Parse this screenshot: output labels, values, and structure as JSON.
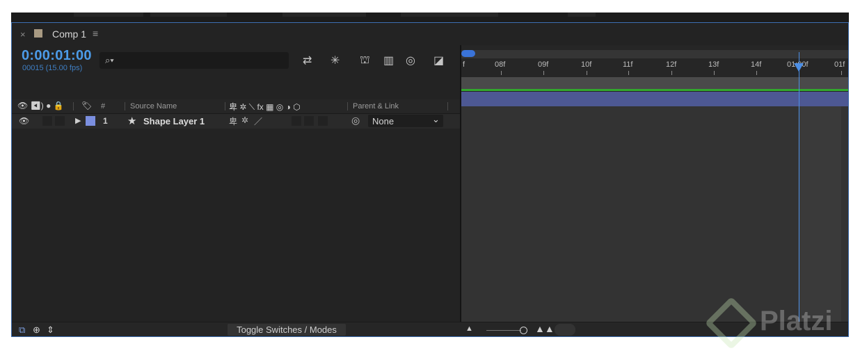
{
  "composition_tab": {
    "close_glyph": "×",
    "label": "Comp 1",
    "menu_glyph": "≡"
  },
  "timecode": {
    "current": "0:00:01:00",
    "frames": "00015 (15.00 fps)"
  },
  "search": {
    "icon": "search-icon",
    "glyph": "⌕▾"
  },
  "toolbar_icons": [
    {
      "name": "comp-mini-flowchart-icon",
      "glyph": "⇄"
    },
    {
      "name": "draft-3d-icon",
      "glyph": "✳"
    },
    {
      "name": "shy-layers-icon",
      "glyph": "⛫"
    },
    {
      "name": "frame-blending-icon",
      "glyph": "▥"
    },
    {
      "name": "motion-blur-icon",
      "glyph": "◎"
    },
    {
      "name": "graph-editor-icon",
      "glyph": "◪"
    }
  ],
  "columns": {
    "av_icons": "👁 ◀) ● 🔒",
    "label_icon": "🏷",
    "number": "#",
    "source_name": "Source Name",
    "switches_icons": "卑 ✲ ⟍ fx ▦ ◎ ◑ ⬡",
    "parent_link": "Parent & Link"
  },
  "layer": {
    "number": "1",
    "name": "Shape Layer 1",
    "label_color": "#7b8fe0",
    "switch_shy": "卑",
    "switch_collapse": "✲",
    "switch_quality": "／",
    "parent_icon": "◎",
    "parent_value": "None",
    "parent_chevron": "⌄"
  },
  "ruler": {
    "start_label": "f",
    "ticks": [
      "08f",
      "09f",
      "10f",
      "11f",
      "12f",
      "13f",
      "14f",
      "01:00f",
      "01f"
    ]
  },
  "bottom": {
    "toggle_label": "Toggle Switches / Modes"
  },
  "watermark": {
    "text": "Platzi"
  },
  "colors": {
    "timecode": "#4c9be8",
    "playhead": "#4c8fe6",
    "layer_bar": "#4d5893",
    "green_bar": "#33a92d"
  }
}
